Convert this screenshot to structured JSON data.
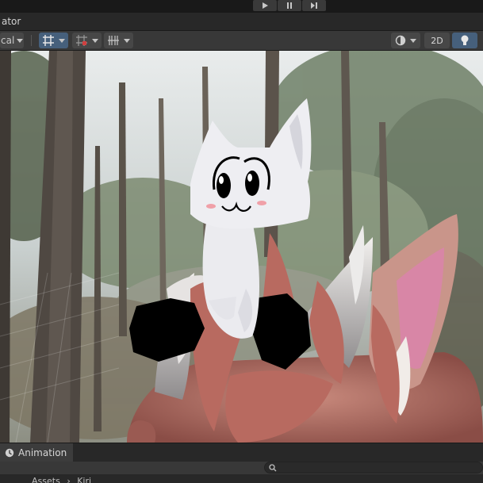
{
  "window": {
    "title_fragment": "ator"
  },
  "toolbar": {
    "shading_label": "cal",
    "mode_2d_label": "2D"
  },
  "animation_panel": {
    "tab_label": "Animation",
    "search_placeholder": "",
    "breadcrumb": [
      "Assets",
      "Kiri"
    ]
  },
  "icons": [
    "play-icon",
    "pause-icon",
    "step-icon",
    "grid-icon",
    "snap-icon",
    "increment-icon",
    "gizmo-icon",
    "lighting-icon",
    "animation-icon",
    "search-icon"
  ],
  "colors": {
    "active_toggle": "#46607c",
    "toolbar_bg": "#383838",
    "panel_bg": "#282828"
  }
}
